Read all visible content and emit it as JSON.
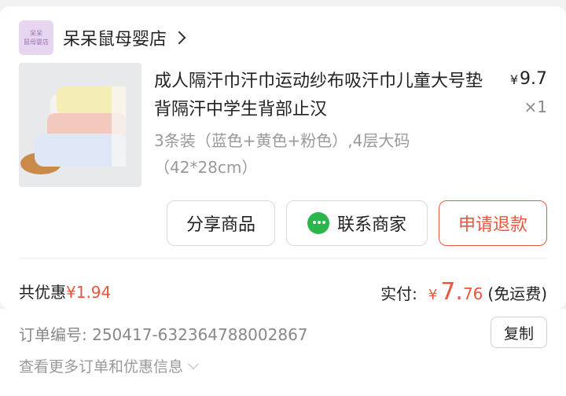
{
  "shop": {
    "logo_line1": "呆呆",
    "logo_line2": "鼠母婴店",
    "name": "呆呆鼠母婴店"
  },
  "product": {
    "title": "成人隔汗巾汗巾运动纱布吸汗巾儿童大号垫背隔汗中学生背部止汉",
    "price_symbol": "¥",
    "price": "9.7",
    "quantity": "×1",
    "sku": "3条装（蓝色+黄色+粉色）,4层大码（42*28cm）"
  },
  "actions": {
    "share": "分享商品",
    "contact": "联系商家",
    "refund": "申请退款"
  },
  "summary": {
    "discount_label": "共优惠",
    "discount_amount": "¥1.94",
    "paid_label": "实付:",
    "paid_symbol": "¥",
    "paid_int": "7.",
    "paid_dec": "76",
    "shipping": "(免运费)"
  },
  "order": {
    "number_text": "订单编号:  250417-632364788002867",
    "copy": "复制",
    "more": "查看更多订单和优惠信息"
  },
  "colors": {
    "accent": "#e9563c",
    "wechat_green": "#2ab64b"
  }
}
